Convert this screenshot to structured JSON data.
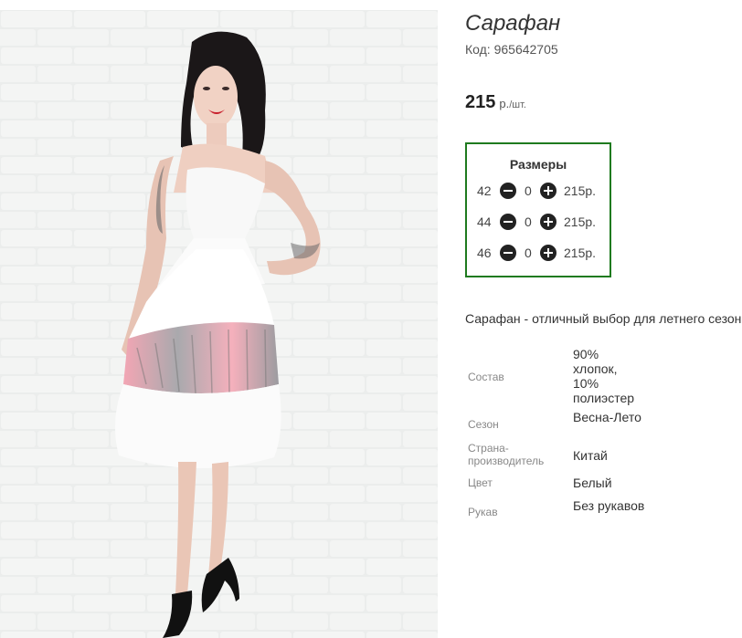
{
  "product": {
    "title": "Сарафан",
    "code": "Код: 965642705",
    "price_amount": "215",
    "price_unit": "р.",
    "price_per": "/шт."
  },
  "sizes": {
    "title": "Размеры",
    "rows": [
      {
        "size": "42",
        "qty": "0",
        "sum": "215р."
      },
      {
        "size": "44",
        "qty": "0",
        "sum": "215р."
      },
      {
        "size": "46",
        "qty": "0",
        "sum": "215р."
      }
    ],
    "border_color": "#1f7a1f"
  },
  "description": "Сарафан - отличный выбор для летнего сезона",
  "attributes": [
    {
      "label": "Состав",
      "value": "90% хлопок, 10% полиэстер"
    },
    {
      "label": "Сезон",
      "value": "Весна-Лето"
    },
    {
      "label": "Страна-производитель",
      "value": "Китай"
    },
    {
      "label": "Цвет",
      "value": "Белый"
    },
    {
      "label": "Рукав",
      "value": "Без рукавов"
    }
  ],
  "icons": {
    "minus": "minus-circle-icon",
    "plus": "plus-circle-icon"
  }
}
